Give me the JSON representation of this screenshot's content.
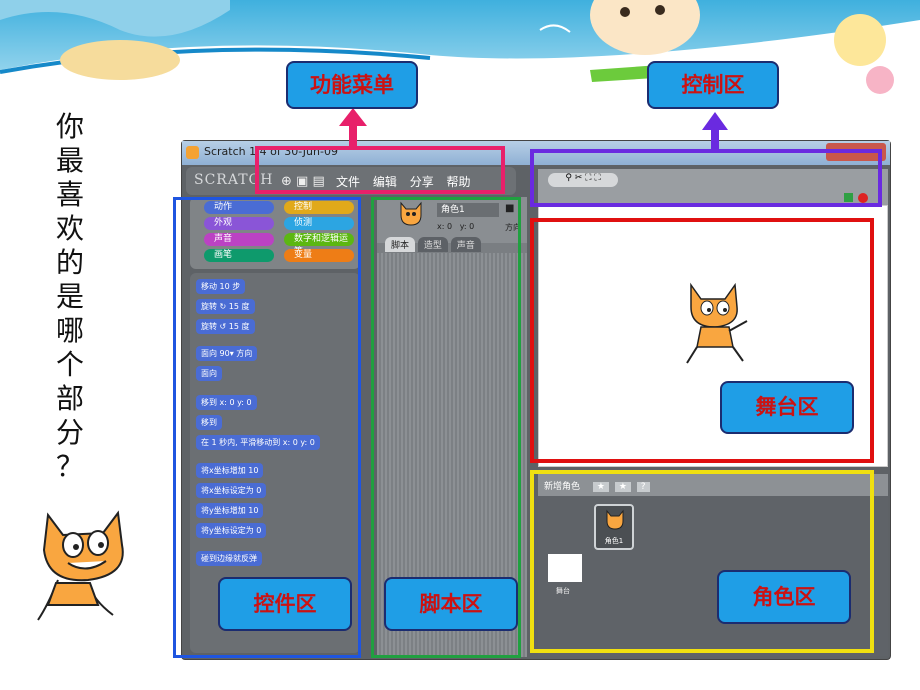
{
  "side_text": [
    "你",
    "最",
    "喜",
    "欢",
    "的",
    "是",
    "哪",
    "个",
    "部",
    "分",
    "？"
  ],
  "window": {
    "title": "Scratch 1.4 of 30-Jun-09",
    "logo": "SCRATCH"
  },
  "menu": {
    "items": [
      "文件",
      "编辑",
      "分享",
      "帮助"
    ]
  },
  "categories": [
    "动作",
    "控制",
    "外观",
    "侦测",
    "声音",
    "数字和逻辑运算",
    "画笔",
    "变量"
  ],
  "blocks": [
    "移动 10 步",
    "旋转 ↻ 15 度",
    "旋转 ↺ 15 度",
    "面向 90▾ 方向",
    "面向",
    "移到 x: 0 y: 0",
    "移到",
    "在 1 秒内, 平滑移动到 x: 0 y: 0",
    "将x坐标增加 10",
    "将x坐标设定为 0",
    "将y坐标增加 10",
    "将y坐标设定为 0",
    "碰到边缘就反弹"
  ],
  "script_area": {
    "sprite_name": "角色1",
    "coords": "x: 0   y: 0",
    "direction": "方向",
    "tabs": [
      "脚本",
      "造型",
      "声音"
    ]
  },
  "sprite_panel": {
    "new_sprite": "新增角色",
    "sprite_label": "角色1",
    "stage_label": "舞台"
  },
  "callouts": {
    "menu": "功能菜单",
    "control": "控制区",
    "stage": "舞台区",
    "blocks": "控件区",
    "script": "脚本区",
    "sprites": "角色区"
  },
  "colors": {
    "callout_bg": "#1f9ee6",
    "callout_text": "#cc1212",
    "menu_frame": "#e8206a",
    "control_frame": "#6a2ae0",
    "stage_frame": "#e01010",
    "blocks_frame": "#1f55e0",
    "script_frame": "#20a040",
    "sprites_frame": "#f0e010"
  }
}
